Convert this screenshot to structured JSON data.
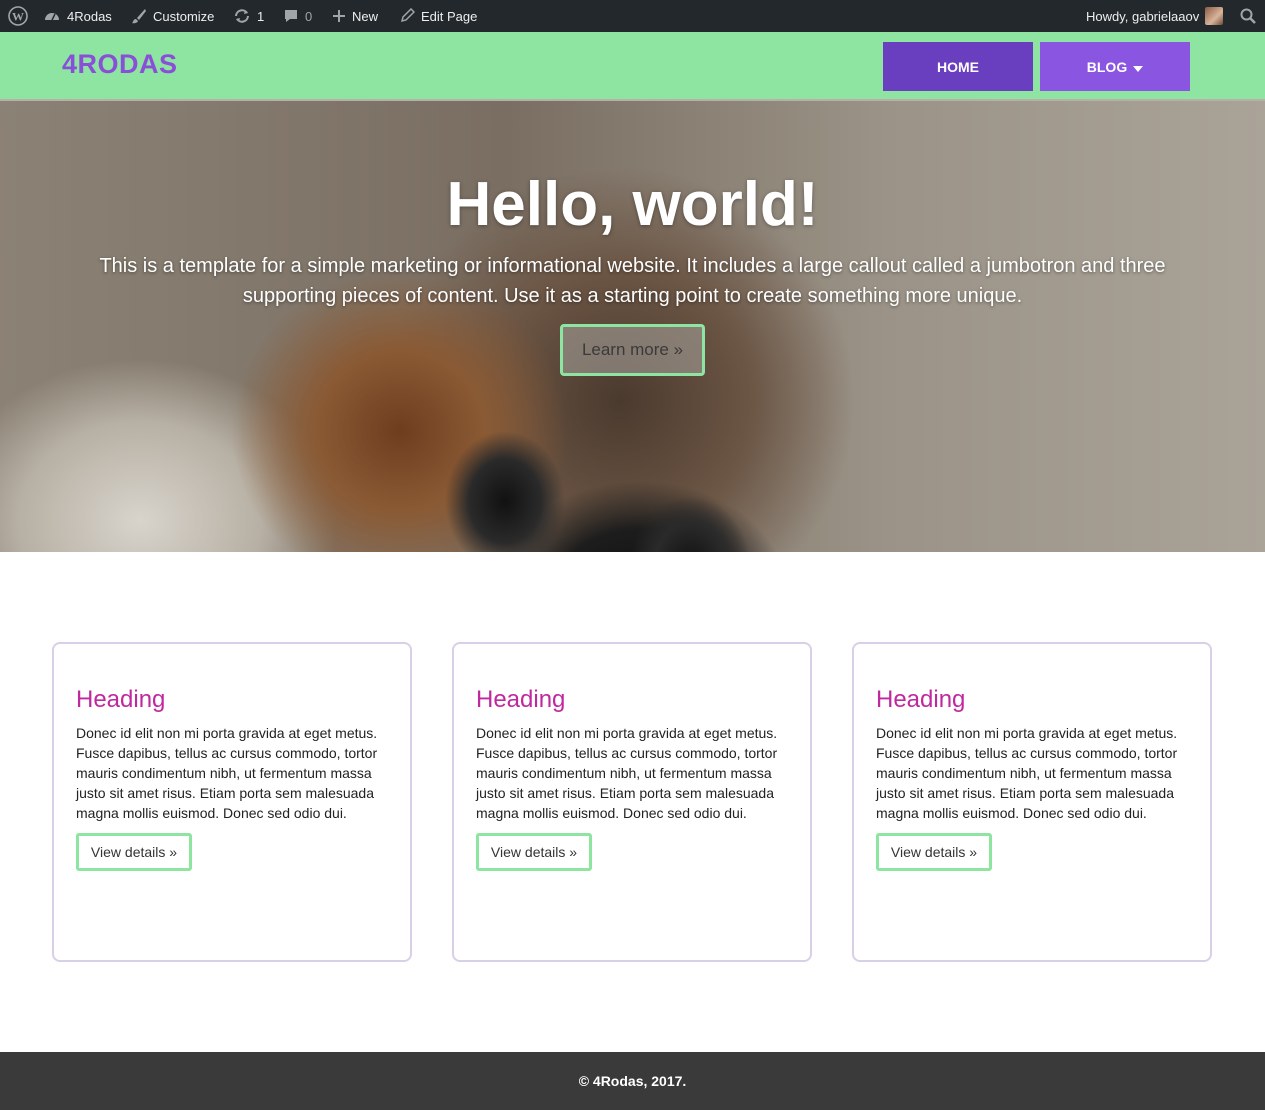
{
  "admin_bar": {
    "site_name": "4Rodas",
    "customize": "Customize",
    "updates_count": "1",
    "comments_count": "0",
    "new": "New",
    "edit_page": "Edit Page",
    "howdy": "Howdy, gabrielaaov"
  },
  "header": {
    "brand": "4RODAS",
    "nav": {
      "home": "HOME",
      "blog": "BLOG"
    }
  },
  "hero": {
    "title": "Hello, world!",
    "text": "This is a template for a simple marketing or informational website. It includes a large callout called a jumbotron and three supporting pieces of content. Use it as a starting point to create something more unique.",
    "button": "Learn more »"
  },
  "cards": [
    {
      "heading": "Heading",
      "body": "Donec id elit non mi porta gravida at eget metus. Fusce dapibus, tellus ac cursus commodo, tortor mauris condimentum nibh, ut fermentum massa justo sit amet risus. Etiam porta sem malesuada magna mollis euismod. Donec sed odio dui.",
      "button": "View details »"
    },
    {
      "heading": "Heading",
      "body": "Donec id elit non mi porta gravida at eget metus. Fusce dapibus, tellus ac cursus commodo, tortor mauris condimentum nibh, ut fermentum massa justo sit amet risus. Etiam porta sem malesuada magna mollis euismod. Donec sed odio dui.",
      "button": "View details »"
    },
    {
      "heading": "Heading",
      "body": "Donec id elit non mi porta gravida at eget metus. Fusce dapibus, tellus ac cursus commodo, tortor mauris condimentum nibh, ut fermentum massa justo sit amet risus. Etiam porta sem malesuada magna mollis euismod. Donec sed odio dui.",
      "button": "View details »"
    }
  ],
  "footer": {
    "text": "© 4Rodas, 2017."
  },
  "colors": {
    "admin_bar_bg": "#23282d",
    "header_bg": "#8de5a1",
    "brand": "#8a4fd8",
    "nav_home": "#6a3fbf",
    "nav_blog": "#8a55e0",
    "card_heading": "#c0299e",
    "accent_border": "#8de5a1",
    "footer_bg": "#3a3a3a"
  },
  "icons": [
    "wordpress-icon",
    "dashboard-icon",
    "brush-icon",
    "updates-icon",
    "comment-icon",
    "plus-icon",
    "pencil-icon",
    "avatar",
    "search-icon",
    "caret-down-icon"
  ]
}
